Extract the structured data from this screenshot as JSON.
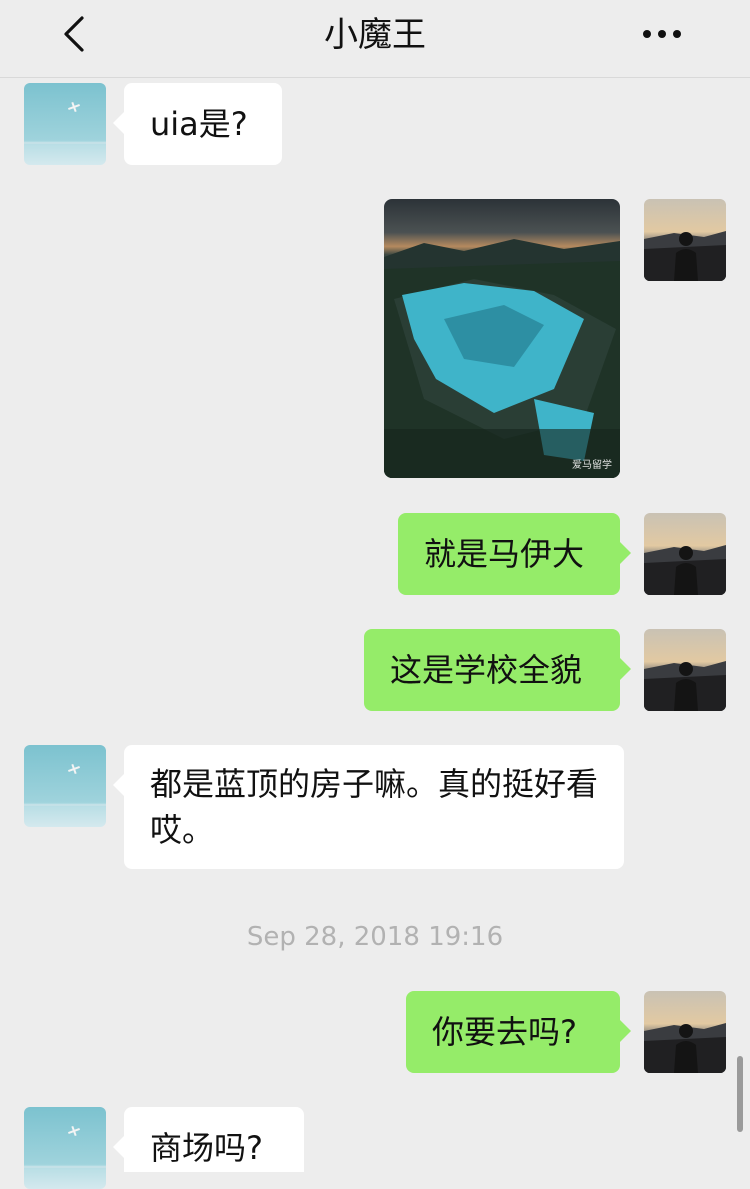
{
  "header": {
    "title": "小魔王",
    "back_icon": "chevron-left-icon",
    "more_icon": "more-horizontal-icon"
  },
  "messages": [
    {
      "side": "left",
      "type": "text",
      "text": "uia是?"
    },
    {
      "side": "right",
      "type": "image",
      "watermark": "爱马留学"
    },
    {
      "side": "right",
      "type": "text",
      "text": "就是马伊大"
    },
    {
      "side": "right",
      "type": "text",
      "text": "这是学校全貌"
    },
    {
      "side": "left",
      "type": "text",
      "text": "都是蓝顶的房子嘛。真的挺好看哎。"
    },
    {
      "side": "right",
      "type": "text",
      "text": "你要去吗?"
    },
    {
      "side": "left",
      "type": "text",
      "text": "商场吗?"
    }
  ],
  "timestamp": "Sep 28, 2018 19:16",
  "colors": {
    "background": "#ededed",
    "sent_bubble": "#95ec69",
    "received_bubble": "#ffffff"
  }
}
